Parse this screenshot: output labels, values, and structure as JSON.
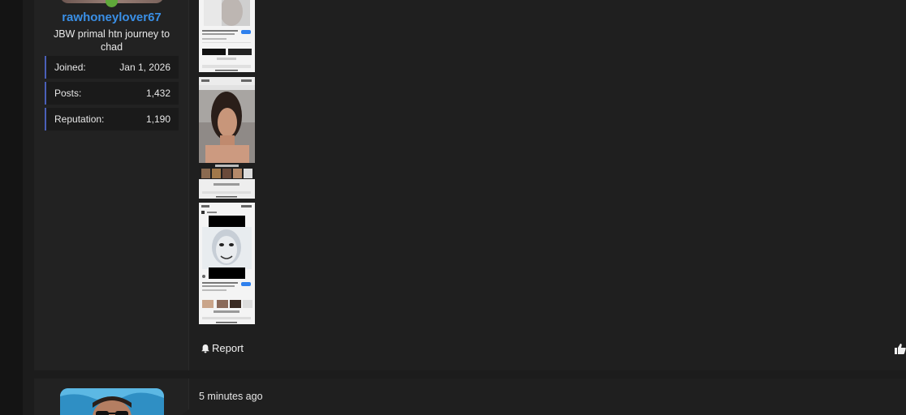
{
  "post1": {
    "username": "rawhoneylover67",
    "user_title": "JBW primal htn journey to chad",
    "stats": [
      {
        "label": "Joined:",
        "value": "Jan 1, 2026"
      },
      {
        "label": "Posts:",
        "value": "1,432"
      },
      {
        "label": "Reputation:",
        "value": "1,190"
      }
    ],
    "report_label": "Report"
  },
  "post2": {
    "timestamp": "5 minutes ago"
  }
}
